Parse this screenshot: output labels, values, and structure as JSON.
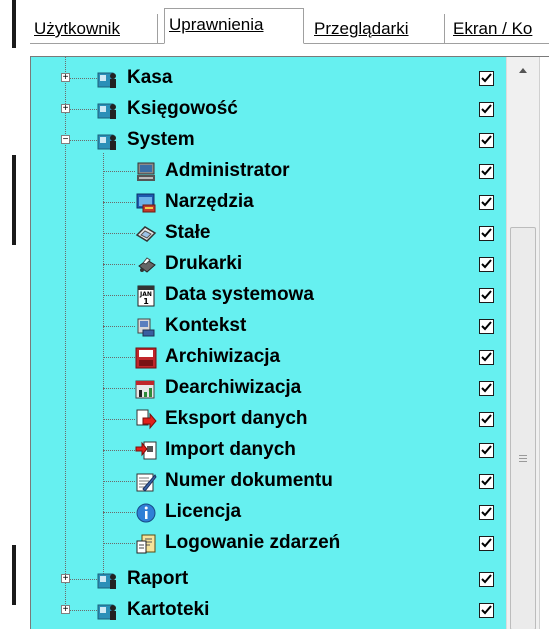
{
  "tabs": [
    {
      "label": "Użytkownik",
      "active": false
    },
    {
      "label": "Uprawnienia",
      "active": true
    },
    {
      "label": "Przeglądarki",
      "active": false
    },
    {
      "label": "Ekran / Ko",
      "active": false
    }
  ],
  "tree": {
    "items": [
      {
        "label": "Kasa",
        "icon": "user-card-icon",
        "expander": "+",
        "checked": true
      },
      {
        "label": "Księgowość",
        "icon": "user-card-icon",
        "expander": "+",
        "checked": true
      },
      {
        "label": "System",
        "icon": "user-card-icon",
        "expander": "−",
        "checked": true
      },
      {
        "label": "Administrator",
        "icon": "administrator-computer-icon",
        "checked": true
      },
      {
        "label": "Narzędzia",
        "icon": "tools-window-icon",
        "checked": true
      },
      {
        "label": "Stałe",
        "icon": "diamond-constant-icon",
        "checked": true
      },
      {
        "label": "Drukarki",
        "icon": "printer-icon",
        "checked": true
      },
      {
        "label": "Data systemowa",
        "icon": "calendar-jan-1-icon",
        "calendar_month": "JAN",
        "calendar_day": "1",
        "checked": true
      },
      {
        "label": "Kontekst",
        "icon": "context-window-icon",
        "checked": true
      },
      {
        "label": "Archiwizacja",
        "icon": "archive-red-disk-icon",
        "checked": true
      },
      {
        "label": "Dearchiwizacja",
        "icon": "dearchive-disk-icon",
        "checked": true
      },
      {
        "label": "Eksport danych",
        "icon": "export-arrow-icon",
        "checked": true
      },
      {
        "label": "Import danych",
        "icon": "import-arrow-icon",
        "checked": true
      },
      {
        "label": "Numer dokumentu",
        "icon": "document-number-pen-icon",
        "checked": true
      },
      {
        "label": "Licencja",
        "icon": "info-circle-icon",
        "checked": true
      },
      {
        "label": "Logowanie zdarzeń",
        "icon": "event-log-icon",
        "checked": true
      },
      {
        "label": "Raport",
        "icon": "user-card-icon",
        "expander": "+",
        "checked": true
      },
      {
        "label": "Kartoteki",
        "icon": "user-card-icon",
        "expander": "+",
        "checked": true
      }
    ]
  },
  "colors": {
    "tree_background": "#66f0f0",
    "scrollbar": "#f0f0f0"
  }
}
